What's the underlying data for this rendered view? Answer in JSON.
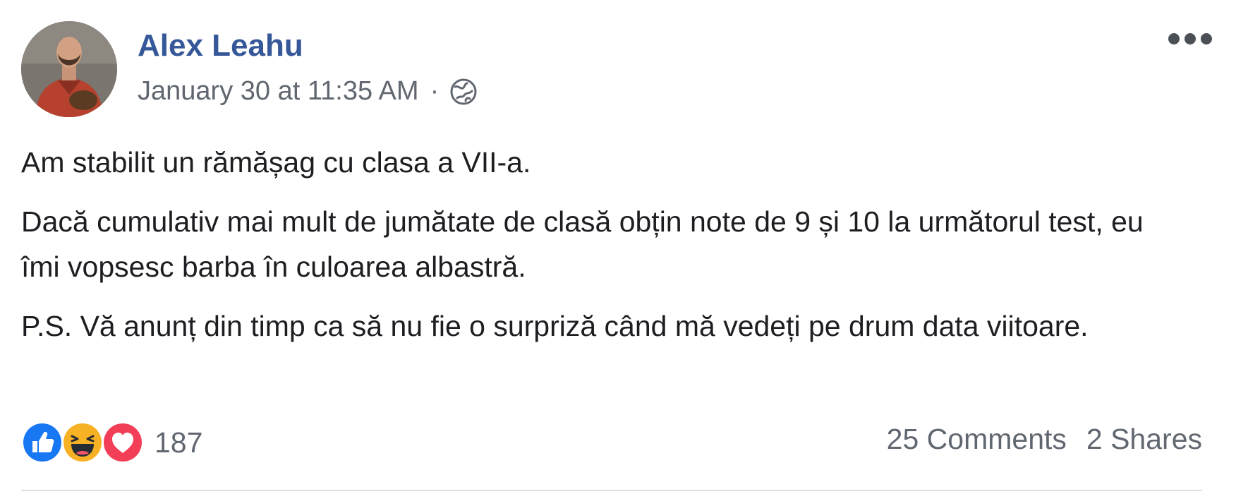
{
  "post": {
    "author_name": "Alex Leahu",
    "timestamp": "January 30 at 11:35 AM",
    "separator": "·",
    "privacy_icon": "globe-icon",
    "more_icon": "more-options-icon",
    "paragraphs": [
      "Am stabilit un rămășag cu clasa a VII-a.",
      "Dacă cumulativ mai mult de jumătate de clasă obțin note de 9 și 10 la următorul test, eu îmi vopsesc barba în culoarea albastră.",
      "P.S. Vă anunț din timp ca să nu fie o surpriză când mă vedeți pe drum data viitoare."
    ]
  },
  "footer": {
    "reaction_icons": [
      "like-icon",
      "haha-icon",
      "love-icon"
    ],
    "reaction_count": "187",
    "comments": "25 Comments",
    "shares": "2 Shares"
  },
  "colors": {
    "author_link": "#365899",
    "secondary_text": "#616770",
    "body_text": "#1c1e21",
    "like_blue": "#1877f2",
    "haha_yellow": "#f7b125",
    "love_red": "#f33e58",
    "divider": "#dadde1"
  }
}
